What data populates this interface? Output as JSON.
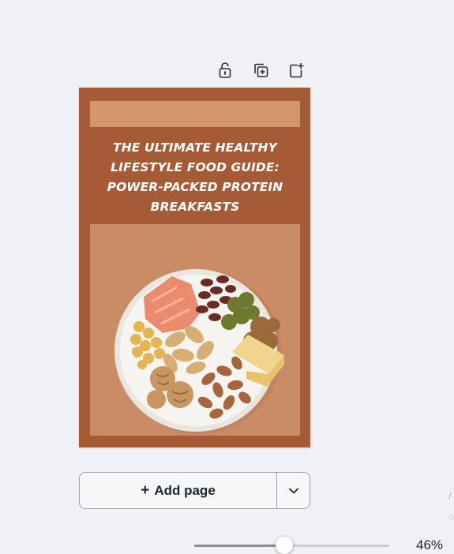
{
  "toolbar": {
    "icons": [
      "lock-open-icon",
      "duplicate-page-icon",
      "add-page-icon"
    ]
  },
  "design": {
    "headline_lines": [
      "THE ULTIMATE HEALTHY",
      "LIFESTYLE FOOD GUIDE:",
      "POWER-PACKED PROTEIN",
      "BREAKFASTS"
    ],
    "colors": {
      "page_bg": "#a55c36",
      "title_bar": "#d4976c",
      "photo_bg": "#c88a62"
    }
  },
  "add_page": {
    "plus": "+",
    "label": "Add page",
    "more_icon": "chevron-down-icon"
  },
  "zoom": {
    "label": "46%",
    "value": 0.46
  }
}
